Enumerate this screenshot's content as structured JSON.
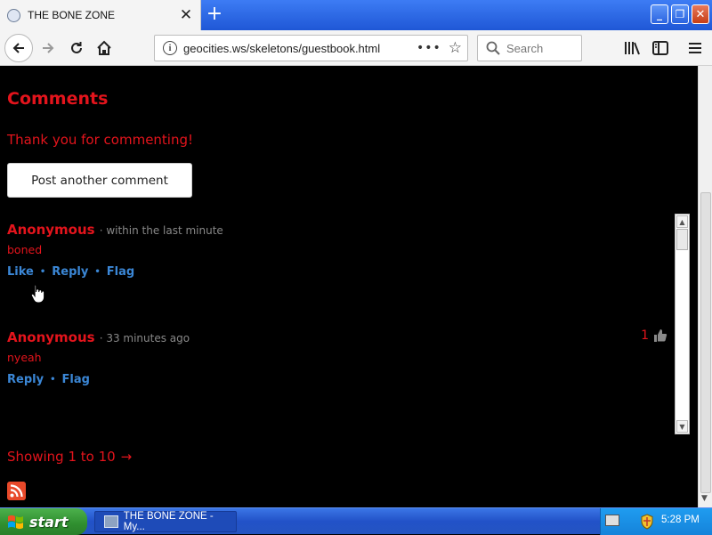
{
  "browser": {
    "tab_title": "THE BONE ZONE",
    "tab_close": "✕",
    "new_tab": "+",
    "url": "geocities.ws/skeletons/guestbook.html",
    "url_more": "•••",
    "search_placeholder": "Search",
    "window_buttons": {
      "minimize": "_",
      "maximize": "❐",
      "close": "✕"
    }
  },
  "page": {
    "heading": "Comments",
    "thanks_message": "Thank you for commenting!",
    "post_button": "Post another comment",
    "comments": [
      {
        "author": "Anonymous",
        "meta": "· within the last minute",
        "body": "boned",
        "actions": [
          "Like",
          "Reply",
          "Flag"
        ],
        "votes": ""
      },
      {
        "author": "Anonymous",
        "meta": "· 33 minutes ago",
        "body": "nyeah",
        "actions": [
          "Reply",
          "Flag"
        ],
        "votes": "1"
      }
    ],
    "showing": "Showing 1 to 10",
    "showing_arrow": "→"
  },
  "taskbar": {
    "start_label": "start",
    "task_label": "THE BONE ZONE - My...",
    "clock": "5:28 PM"
  },
  "colors": {
    "accent_red": "#e3141c",
    "link_blue": "#3b87d6",
    "page_bg": "#000000"
  },
  "icons": [
    "globe-icon",
    "back-arrow-icon",
    "forward-arrow-icon",
    "reload-icon",
    "home-icon",
    "info-icon",
    "star-icon",
    "search-icon",
    "library-icon",
    "sidebar-icon",
    "menu-icon",
    "thumbs-up-icon",
    "rss-icon",
    "windows-flag-icon",
    "shield-icon",
    "keyboard-icon",
    "hand-cursor-icon"
  ]
}
